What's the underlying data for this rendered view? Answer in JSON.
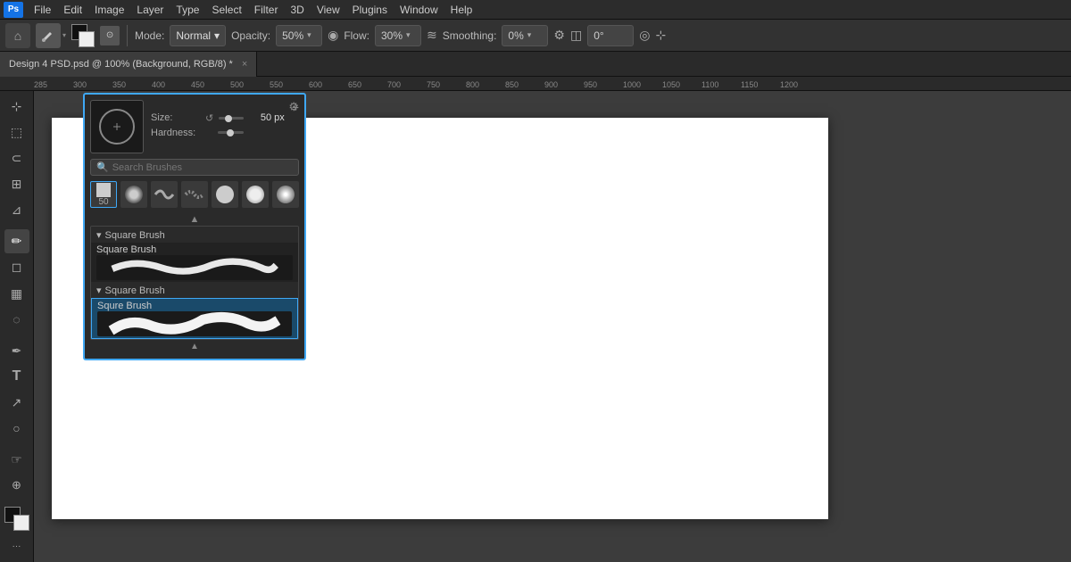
{
  "app": {
    "logo": "Ps",
    "title": "Design 4 PSD.psd @ 100% (Background, RGB/8) *"
  },
  "menu": {
    "items": [
      "File",
      "Edit",
      "Image",
      "Layer",
      "Type",
      "Select",
      "Filter",
      "3D",
      "View",
      "Plugins",
      "Window",
      "Help"
    ]
  },
  "toolbar": {
    "mode_label": "Mode:",
    "mode_value": "Normal",
    "opacity_label": "Opacity:",
    "opacity_value": "50%",
    "flow_label": "Flow:",
    "flow_value": "30%",
    "smoothing_label": "Smoothing:",
    "smoothing_value": "0%",
    "angle_value": "0°"
  },
  "tab": {
    "label": "Design 4 PSD.psd @ 100% (Background, RGB/8) *",
    "close": "×"
  },
  "brush_panel": {
    "size_label": "Size:",
    "size_value": "50 px",
    "hardness_label": "Hardness:",
    "search_placeholder": "Search Brushes",
    "preset_size": "50",
    "brush_groups": [
      {
        "name": "Square Brush",
        "brushes": [
          {
            "name": "Square Brush",
            "selected": false
          },
          {
            "name": "Square Brush",
            "selected": false
          },
          {
            "name": "Squre Brush",
            "selected": true
          }
        ]
      }
    ]
  },
  "ruler_labels": [
    "285",
    "300",
    "350",
    "400",
    "450",
    "500",
    "550",
    "600",
    "650",
    "700",
    "750",
    "800",
    "850",
    "900",
    "950",
    "1000",
    "1050",
    "1100",
    "1150",
    "1200"
  ],
  "canvas": {
    "zoom": "100%",
    "mode": "Background, RGB/8"
  },
  "icons": {
    "home": "⌂",
    "brush": "✏",
    "settings": "⚙",
    "add": "+",
    "search": "🔍",
    "chevron_down": "▾",
    "refresh": "↺",
    "scroll_up": "▲",
    "scroll_down": "▼",
    "check": "✓",
    "angle_icon": "◫",
    "smoothing_icon": "≈",
    "flow_icon": "≋",
    "opacity_icon": "◉",
    "erase_icon": "⊙",
    "target_icon": "◎",
    "dots": "•••"
  },
  "left_tools": [
    {
      "name": "move",
      "icon": "⊹",
      "active": false
    },
    {
      "name": "lasso",
      "icon": "⬚",
      "active": false
    },
    {
      "name": "crop",
      "icon": "⊞",
      "active": false
    },
    {
      "name": "eyedropper",
      "icon": "⊿",
      "active": false
    },
    {
      "name": "healing",
      "icon": "✚",
      "active": false
    },
    {
      "name": "brush",
      "icon": "✏",
      "active": true
    },
    {
      "name": "clone-stamp",
      "icon": "⊕",
      "active": false
    },
    {
      "name": "eraser",
      "icon": "◻",
      "active": false
    },
    {
      "name": "gradient",
      "icon": "▦",
      "active": false
    },
    {
      "name": "blur",
      "icon": "◌",
      "active": false
    },
    {
      "name": "dodge",
      "icon": "◐",
      "active": false
    },
    {
      "name": "pen",
      "icon": "✒",
      "active": false
    },
    {
      "name": "text",
      "icon": "T",
      "active": false
    },
    {
      "name": "path",
      "icon": "↗",
      "active": false
    },
    {
      "name": "shape",
      "icon": "○",
      "active": false
    },
    {
      "name": "hand",
      "icon": "☞",
      "active": false
    },
    {
      "name": "zoom",
      "icon": "⊕",
      "active": false
    },
    {
      "name": "more-tools",
      "icon": "···",
      "active": false
    }
  ]
}
